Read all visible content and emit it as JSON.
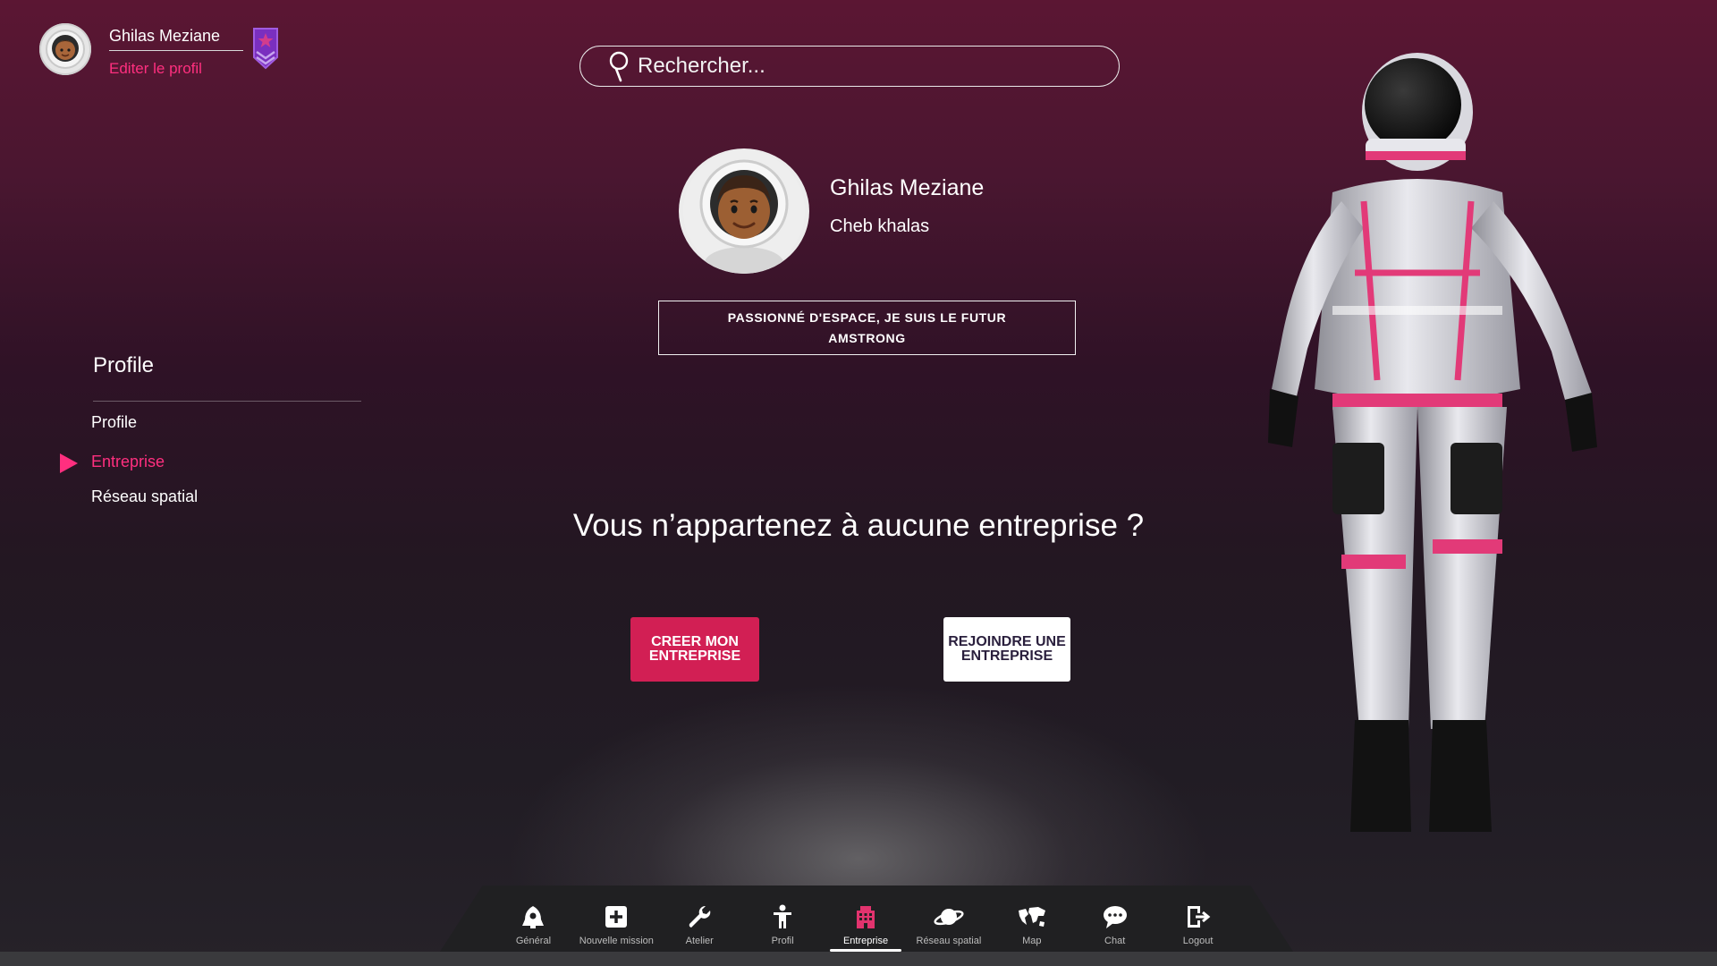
{
  "user": {
    "name": "Ghilas Meziane",
    "edit_label": "Editer le profil"
  },
  "search": {
    "placeholder": "Rechercher..."
  },
  "profile": {
    "name": "Ghilas Meziane",
    "subtitle": "Cheb khalas",
    "bio": "PASSIONNÉ D'ESPACE, JE SUIS LE FUTUR AMSTRONG"
  },
  "side_menu": {
    "title": "Profile",
    "items": [
      {
        "label": "Profile"
      },
      {
        "label": "Entreprise",
        "active": true
      },
      {
        "label": "Réseau spatial"
      }
    ]
  },
  "main": {
    "question": "Vous n’appartenez à aucune entreprise ?",
    "create_label": "CREER MON ENTREPRISE",
    "join_label": "REJOINDRE UNE ENTREPRISE"
  },
  "nav": {
    "items": [
      {
        "label": "Général",
        "icon": "rocket-icon"
      },
      {
        "label": "Nouvelle mission",
        "icon": "plus-square-icon"
      },
      {
        "label": "Atelier",
        "icon": "wrench-icon"
      },
      {
        "label": "Profil",
        "icon": "person-icon"
      },
      {
        "label": "Entreprise",
        "icon": "building-icon",
        "active": true
      },
      {
        "label": "Réseau spatial",
        "icon": "planet-icon"
      },
      {
        "label": "Map",
        "icon": "world-map-icon"
      },
      {
        "label": "Chat",
        "icon": "chat-bubble-icon"
      },
      {
        "label": "Logout",
        "icon": "logout-icon"
      }
    ]
  },
  "colors": {
    "accent": "#ff2f7f",
    "button_primary": "#d21f54",
    "background_top": "#5b1633",
    "background_bottom": "#262229"
  }
}
